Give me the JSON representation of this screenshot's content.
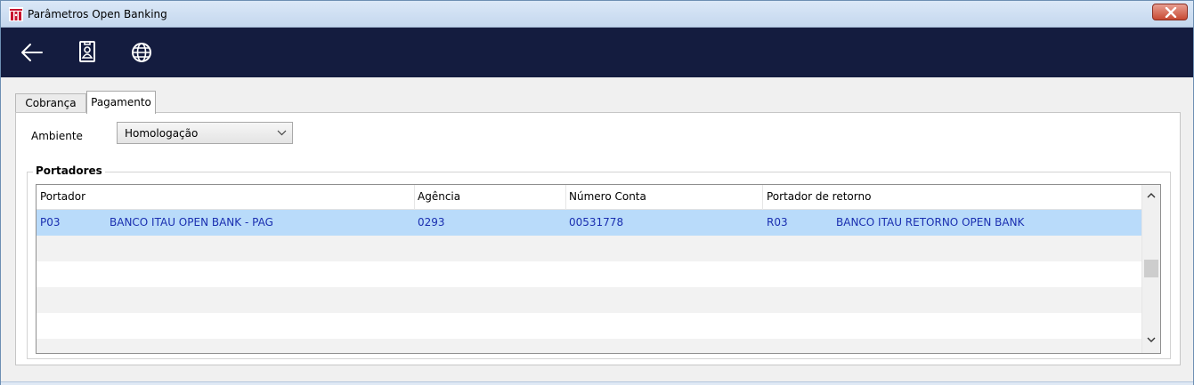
{
  "window": {
    "title": "Parâmetros Open Banking"
  },
  "toolbar": {
    "buttons": [
      {
        "icon": "arrow-left-icon"
      },
      {
        "icon": "id-badge-icon"
      },
      {
        "icon": "globe-icon"
      }
    ]
  },
  "tabs": [
    {
      "label": "Cobrança",
      "active": false
    },
    {
      "label": "Pagamento",
      "active": true
    }
  ],
  "ambiente": {
    "label": "Ambiente",
    "value": "Homologação"
  },
  "portadores": {
    "title": "Portadores",
    "columns": [
      "Portador",
      "Agência",
      "Número Conta",
      "Portador de retorno"
    ],
    "rows": [
      {
        "portador_code": "P03",
        "portador_name": "BANCO ITAU OPEN BANK - PAG",
        "agencia": "0293",
        "numero_conta": "00531778",
        "retorno_code": "R03",
        "retorno_name": "BANCO ITAU RETORNO OPEN BANK"
      }
    ]
  },
  "colors": {
    "toolbar_bg": "#141c3f",
    "selected_row": "#b9dbfa",
    "row_text": "#1a2fb0"
  }
}
